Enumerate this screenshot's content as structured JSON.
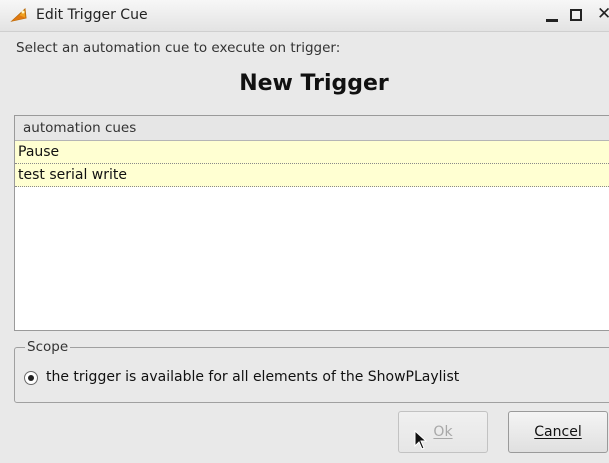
{
  "window": {
    "title": "Edit Trigger Cue"
  },
  "dialog": {
    "instruction": "Select an automation cue to execute on trigger:",
    "heading": "New Trigger"
  },
  "cue_list": {
    "header": "automation cues",
    "items": [
      {
        "label": "Pause"
      },
      {
        "label": "test serial write"
      }
    ],
    "row_background": "#ffffd2"
  },
  "scope": {
    "legend": "Scope",
    "option_label": "the trigger is available for all elements of the ShowPLaylist",
    "option_selected": true
  },
  "buttons": {
    "ok_label": "Ok",
    "ok_enabled": false,
    "cancel_label": "Cancel"
  },
  "icons": {
    "app": "app-logo-icon",
    "minimize": "minimize-icon",
    "maximize": "maximize-icon",
    "close": "close-icon",
    "cursor": "mouse-pointer-icon"
  }
}
